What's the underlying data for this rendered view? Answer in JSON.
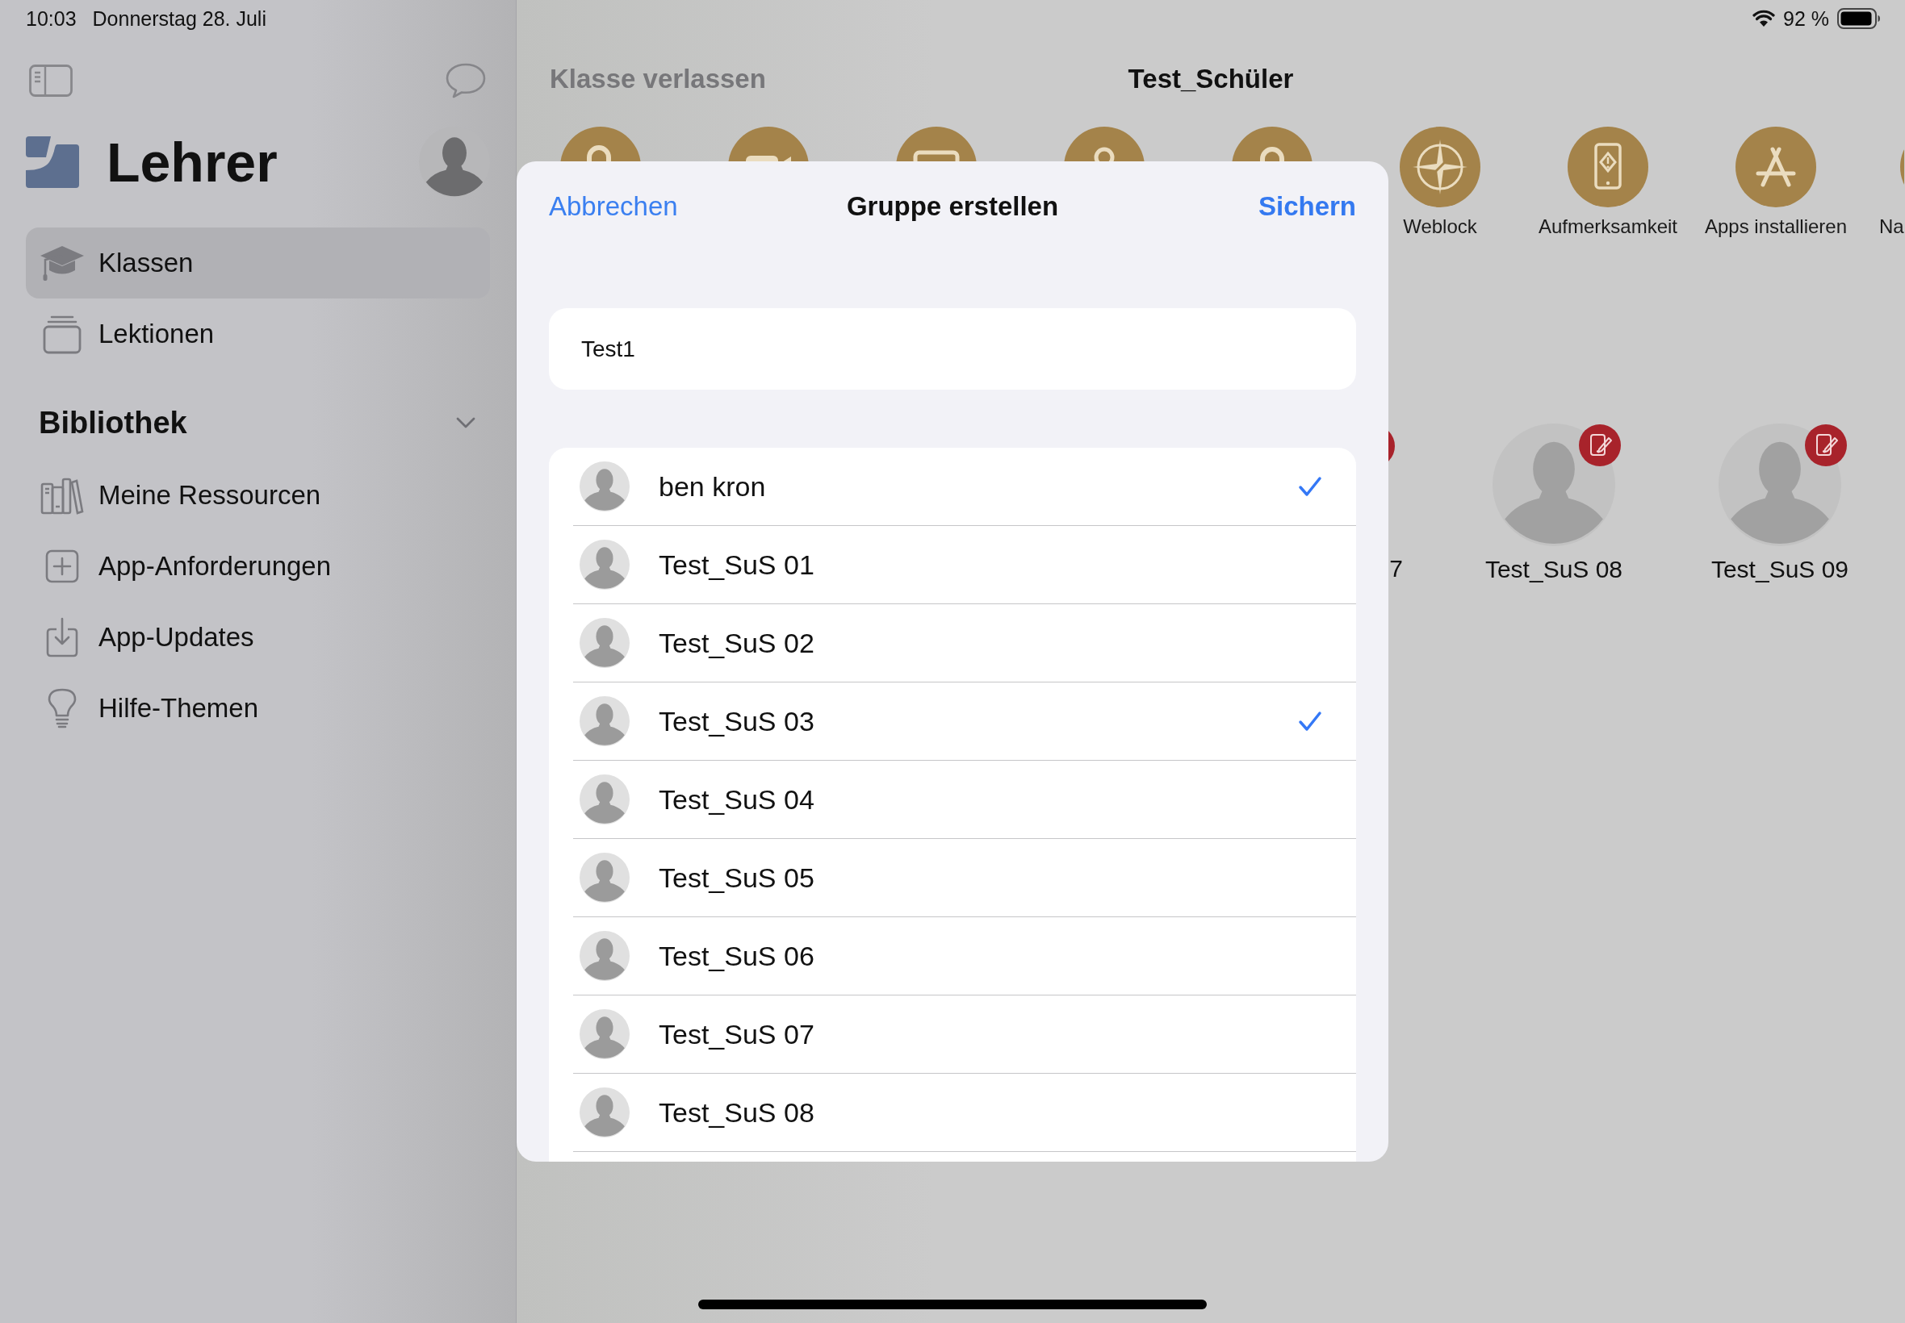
{
  "status_bar": {
    "time": "10:03",
    "date": "Donnerstag 28. Juli",
    "battery_text": "92 %"
  },
  "sidebar": {
    "title": "Lehrer",
    "nav": [
      {
        "kind": "cap",
        "label": "Klassen",
        "selected": true
      },
      {
        "kind": "stack",
        "label": "Lektionen",
        "selected": false
      }
    ],
    "library": {
      "title": "Bibliothek",
      "expanded": true,
      "items": [
        {
          "kind": "books",
          "label": "Meine Ressourcen",
          "selected": false
        },
        {
          "kind": "plus",
          "label": "App-Anforderungen",
          "selected": false
        },
        {
          "kind": "download",
          "label": "App-Updates",
          "selected": false
        },
        {
          "kind": "bulb",
          "label": "Hilfe-Themen",
          "selected": false
        }
      ]
    }
  },
  "header": {
    "back": "Klasse verlassen",
    "title": "Test_Schüler"
  },
  "toolbar": [
    {
      "kind": "unlock"
    },
    {
      "kind": "camera"
    },
    {
      "kind": "screen"
    },
    {
      "kind": "person"
    },
    {
      "kind": "lock"
    },
    {
      "kind": "compass",
      "label": "Weblock"
    },
    {
      "kind": "tablet-alert",
      "label": "Aufmerksamkeit"
    },
    {
      "kind": "apps",
      "label": "Apps installieren"
    },
    {
      "kind": "cut",
      "label": "Na"
    }
  ],
  "students": [
    {
      "kind": "cut",
      "name": "7",
      "badge": true
    },
    {
      "kind": "card",
      "name": "Test_SuS 08",
      "badge": true
    },
    {
      "kind": "card",
      "name": "Test_SuS 09",
      "badge": true
    }
  ],
  "group_dialog": {
    "cancel": "Abbrechen",
    "title": "Gruppe erstellen",
    "save": "Sichern",
    "name_field": {
      "value": "Test1"
    },
    "members": [
      {
        "name": "ben kron",
        "checked": true
      },
      {
        "name": "Test_SuS 01",
        "checked": false
      },
      {
        "name": "Test_SuS 02",
        "checked": false
      },
      {
        "name": "Test_SuS 03",
        "checked": true
      },
      {
        "name": "Test_SuS 04",
        "checked": false
      },
      {
        "name": "Test_SuS 05",
        "checked": false
      },
      {
        "name": "Test_SuS 06",
        "checked": false
      },
      {
        "name": "Test_SuS 07",
        "checked": false
      },
      {
        "name": "Test_SuS 08",
        "checked": false
      }
    ]
  }
}
